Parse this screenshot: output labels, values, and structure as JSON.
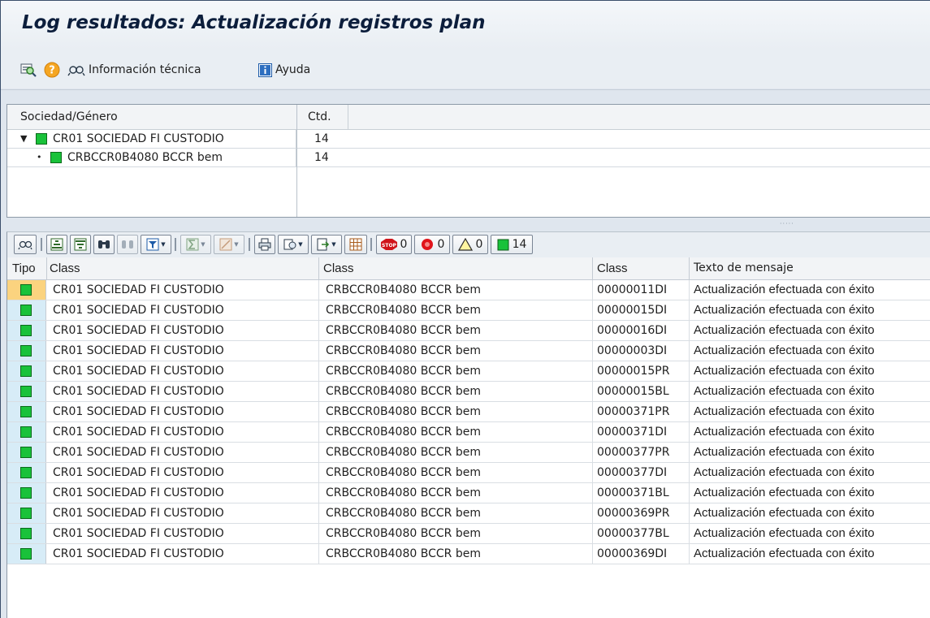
{
  "window": {
    "title": "Log resultados: Actualización registros plan"
  },
  "app_toolbar": {
    "info_tecnica_label": "Información técnica",
    "ayuda_label": "Ayuda",
    "icons": [
      "find-icon",
      "help-icon",
      "technical-info-icon",
      "info-icon"
    ]
  },
  "tree": {
    "headers": {
      "col1": "Sociedad/Género",
      "col2": "Ctd."
    },
    "rows": [
      {
        "label": "CR01 SOCIEDAD FI CUSTODIO",
        "qty": "14",
        "expander": "▼",
        "status_color": "#19c23a"
      },
      {
        "label": "CRBCCR0B4080 BCCR bem",
        "qty": "14",
        "expander": "•",
        "status_color": "#19c23a"
      }
    ]
  },
  "grid_toolbar": {
    "status_counts": {
      "stop": "0",
      "error": "0",
      "warning": "0",
      "success": "14"
    },
    "icons": [
      "technical-info-icon",
      "sort-asc-icon",
      "sort-desc-icon",
      "find-icon",
      "find-next-icon",
      "filter-icon",
      "sum-icon",
      "subtotal-icon",
      "print-icon",
      "view-icon",
      "export-icon",
      "layout-icon",
      "stop-icon",
      "error-icon",
      "warning-icon",
      "success-icon"
    ]
  },
  "grid": {
    "headers": {
      "tipo": "Tipo",
      "class1": "Class",
      "class2": "Class",
      "class3": "Class",
      "texto": "Texto de mensaje"
    },
    "rows": [
      {
        "soc": "CR01 SOCIEDAD FI CUSTODIO",
        "gen": "CRBCCR0B4080 BCCR bem",
        "code": "00000011DI",
        "msg": "Actualización efectuada con éxito"
      },
      {
        "soc": "CR01 SOCIEDAD FI CUSTODIO",
        "gen": "CRBCCR0B4080 BCCR bem",
        "code": "00000015DI",
        "msg": "Actualización efectuada con éxito"
      },
      {
        "soc": "CR01 SOCIEDAD FI CUSTODIO",
        "gen": "CRBCCR0B4080 BCCR bem",
        "code": "00000016DI",
        "msg": "Actualización efectuada con éxito"
      },
      {
        "soc": "CR01 SOCIEDAD FI CUSTODIO",
        "gen": "CRBCCR0B4080 BCCR bem",
        "code": "00000003DI",
        "msg": "Actualización efectuada con éxito"
      },
      {
        "soc": "CR01 SOCIEDAD FI CUSTODIO",
        "gen": "CRBCCR0B4080 BCCR bem",
        "code": "00000015PR",
        "msg": "Actualización efectuada con éxito"
      },
      {
        "soc": "CR01 SOCIEDAD FI CUSTODIO",
        "gen": "CRBCCR0B4080 BCCR bem",
        "code": "00000015BL",
        "msg": "Actualización efectuada con éxito"
      },
      {
        "soc": "CR01 SOCIEDAD FI CUSTODIO",
        "gen": "CRBCCR0B4080 BCCR bem",
        "code": "00000371PR",
        "msg": "Actualización efectuada con éxito"
      },
      {
        "soc": "CR01 SOCIEDAD FI CUSTODIO",
        "gen": "CRBCCR0B4080 BCCR bem",
        "code": "00000371DI",
        "msg": "Actualización efectuada con éxito"
      },
      {
        "soc": "CR01 SOCIEDAD FI CUSTODIO",
        "gen": "CRBCCR0B4080 BCCR bem",
        "code": "00000377PR",
        "msg": "Actualización efectuada con éxito"
      },
      {
        "soc": "CR01 SOCIEDAD FI CUSTODIO",
        "gen": "CRBCCR0B4080 BCCR bem",
        "code": "00000377DI",
        "msg": "Actualización efectuada con éxito"
      },
      {
        "soc": "CR01 SOCIEDAD FI CUSTODIO",
        "gen": "CRBCCR0B4080 BCCR bem",
        "code": "00000371BL",
        "msg": "Actualización efectuada con éxito"
      },
      {
        "soc": "CR01 SOCIEDAD FI CUSTODIO",
        "gen": "CRBCCR0B4080 BCCR bem",
        "code": "00000369PR",
        "msg": "Actualización efectuada con éxito"
      },
      {
        "soc": "CR01 SOCIEDAD FI CUSTODIO",
        "gen": "CRBCCR0B4080 BCCR bem",
        "code": "00000377BL",
        "msg": "Actualización efectuada con éxito"
      },
      {
        "soc": "CR01 SOCIEDAD FI CUSTODIO",
        "gen": "CRBCCR0B4080 BCCR bem",
        "code": "00000369DI",
        "msg": "Actualización efectuada con éxito"
      }
    ],
    "status_color": "#19c23a",
    "selected_tipo_color": "#fbd37f"
  }
}
